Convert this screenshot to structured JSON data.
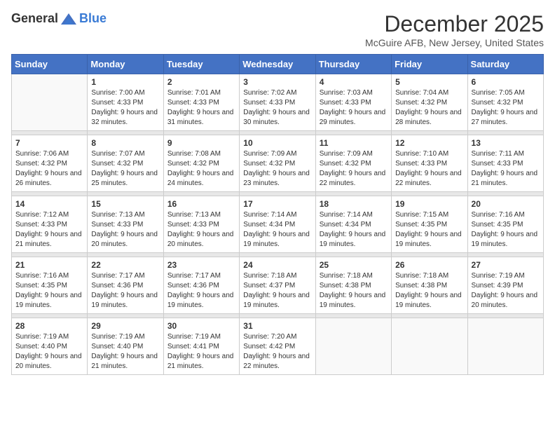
{
  "header": {
    "logo_general": "General",
    "logo_blue": "Blue",
    "month_year": "December 2025",
    "location": "McGuire AFB, New Jersey, United States"
  },
  "days_of_week": [
    "Sunday",
    "Monday",
    "Tuesday",
    "Wednesday",
    "Thursday",
    "Friday",
    "Saturday"
  ],
  "weeks": [
    [
      {
        "day": "",
        "sunrise": "",
        "sunset": "",
        "daylight": "",
        "empty": true
      },
      {
        "day": "1",
        "sunrise": "Sunrise: 7:00 AM",
        "sunset": "Sunset: 4:33 PM",
        "daylight": "Daylight: 9 hours and 32 minutes."
      },
      {
        "day": "2",
        "sunrise": "Sunrise: 7:01 AM",
        "sunset": "Sunset: 4:33 PM",
        "daylight": "Daylight: 9 hours and 31 minutes."
      },
      {
        "day": "3",
        "sunrise": "Sunrise: 7:02 AM",
        "sunset": "Sunset: 4:33 PM",
        "daylight": "Daylight: 9 hours and 30 minutes."
      },
      {
        "day": "4",
        "sunrise": "Sunrise: 7:03 AM",
        "sunset": "Sunset: 4:33 PM",
        "daylight": "Daylight: 9 hours and 29 minutes."
      },
      {
        "day": "5",
        "sunrise": "Sunrise: 7:04 AM",
        "sunset": "Sunset: 4:32 PM",
        "daylight": "Daylight: 9 hours and 28 minutes."
      },
      {
        "day": "6",
        "sunrise": "Sunrise: 7:05 AM",
        "sunset": "Sunset: 4:32 PM",
        "daylight": "Daylight: 9 hours and 27 minutes."
      }
    ],
    [
      {
        "day": "7",
        "sunrise": "Sunrise: 7:06 AM",
        "sunset": "Sunset: 4:32 PM",
        "daylight": "Daylight: 9 hours and 26 minutes."
      },
      {
        "day": "8",
        "sunrise": "Sunrise: 7:07 AM",
        "sunset": "Sunset: 4:32 PM",
        "daylight": "Daylight: 9 hours and 25 minutes."
      },
      {
        "day": "9",
        "sunrise": "Sunrise: 7:08 AM",
        "sunset": "Sunset: 4:32 PM",
        "daylight": "Daylight: 9 hours and 24 minutes."
      },
      {
        "day": "10",
        "sunrise": "Sunrise: 7:09 AM",
        "sunset": "Sunset: 4:32 PM",
        "daylight": "Daylight: 9 hours and 23 minutes."
      },
      {
        "day": "11",
        "sunrise": "Sunrise: 7:09 AM",
        "sunset": "Sunset: 4:32 PM",
        "daylight": "Daylight: 9 hours and 22 minutes."
      },
      {
        "day": "12",
        "sunrise": "Sunrise: 7:10 AM",
        "sunset": "Sunset: 4:33 PM",
        "daylight": "Daylight: 9 hours and 22 minutes."
      },
      {
        "day": "13",
        "sunrise": "Sunrise: 7:11 AM",
        "sunset": "Sunset: 4:33 PM",
        "daylight": "Daylight: 9 hours and 21 minutes."
      }
    ],
    [
      {
        "day": "14",
        "sunrise": "Sunrise: 7:12 AM",
        "sunset": "Sunset: 4:33 PM",
        "daylight": "Daylight: 9 hours and 21 minutes."
      },
      {
        "day": "15",
        "sunrise": "Sunrise: 7:13 AM",
        "sunset": "Sunset: 4:33 PM",
        "daylight": "Daylight: 9 hours and 20 minutes."
      },
      {
        "day": "16",
        "sunrise": "Sunrise: 7:13 AM",
        "sunset": "Sunset: 4:33 PM",
        "daylight": "Daylight: 9 hours and 20 minutes."
      },
      {
        "day": "17",
        "sunrise": "Sunrise: 7:14 AM",
        "sunset": "Sunset: 4:34 PM",
        "daylight": "Daylight: 9 hours and 19 minutes."
      },
      {
        "day": "18",
        "sunrise": "Sunrise: 7:14 AM",
        "sunset": "Sunset: 4:34 PM",
        "daylight": "Daylight: 9 hours and 19 minutes."
      },
      {
        "day": "19",
        "sunrise": "Sunrise: 7:15 AM",
        "sunset": "Sunset: 4:35 PM",
        "daylight": "Daylight: 9 hours and 19 minutes."
      },
      {
        "day": "20",
        "sunrise": "Sunrise: 7:16 AM",
        "sunset": "Sunset: 4:35 PM",
        "daylight": "Daylight: 9 hours and 19 minutes."
      }
    ],
    [
      {
        "day": "21",
        "sunrise": "Sunrise: 7:16 AM",
        "sunset": "Sunset: 4:35 PM",
        "daylight": "Daylight: 9 hours and 19 minutes."
      },
      {
        "day": "22",
        "sunrise": "Sunrise: 7:17 AM",
        "sunset": "Sunset: 4:36 PM",
        "daylight": "Daylight: 9 hours and 19 minutes."
      },
      {
        "day": "23",
        "sunrise": "Sunrise: 7:17 AM",
        "sunset": "Sunset: 4:36 PM",
        "daylight": "Daylight: 9 hours and 19 minutes."
      },
      {
        "day": "24",
        "sunrise": "Sunrise: 7:18 AM",
        "sunset": "Sunset: 4:37 PM",
        "daylight": "Daylight: 9 hours and 19 minutes."
      },
      {
        "day": "25",
        "sunrise": "Sunrise: 7:18 AM",
        "sunset": "Sunset: 4:38 PM",
        "daylight": "Daylight: 9 hours and 19 minutes."
      },
      {
        "day": "26",
        "sunrise": "Sunrise: 7:18 AM",
        "sunset": "Sunset: 4:38 PM",
        "daylight": "Daylight: 9 hours and 19 minutes."
      },
      {
        "day": "27",
        "sunrise": "Sunrise: 7:19 AM",
        "sunset": "Sunset: 4:39 PM",
        "daylight": "Daylight: 9 hours and 20 minutes."
      }
    ],
    [
      {
        "day": "28",
        "sunrise": "Sunrise: 7:19 AM",
        "sunset": "Sunset: 4:40 PM",
        "daylight": "Daylight: 9 hours and 20 minutes."
      },
      {
        "day": "29",
        "sunrise": "Sunrise: 7:19 AM",
        "sunset": "Sunset: 4:40 PM",
        "daylight": "Daylight: 9 hours and 21 minutes."
      },
      {
        "day": "30",
        "sunrise": "Sunrise: 7:19 AM",
        "sunset": "Sunset: 4:41 PM",
        "daylight": "Daylight: 9 hours and 21 minutes."
      },
      {
        "day": "31",
        "sunrise": "Sunrise: 7:20 AM",
        "sunset": "Sunset: 4:42 PM",
        "daylight": "Daylight: 9 hours and 22 minutes."
      },
      {
        "day": "",
        "empty": true
      },
      {
        "day": "",
        "empty": true
      },
      {
        "day": "",
        "empty": true
      }
    ]
  ]
}
